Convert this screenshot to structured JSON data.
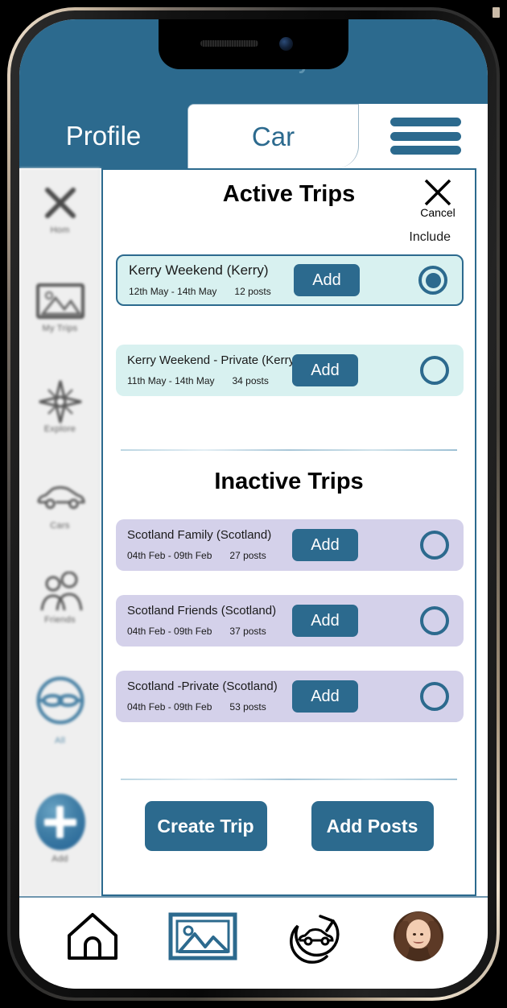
{
  "header": {
    "journey_status": "No Journey",
    "tabs": [
      {
        "label": "Profile",
        "active": false
      },
      {
        "label": "Car",
        "active": true
      }
    ],
    "menu_icon": "hamburger-icon"
  },
  "sidebar": {
    "items": [
      {
        "label": "Hom",
        "icon": "close-x-icon"
      },
      {
        "label": "My Trips",
        "icon": "photo-icon"
      },
      {
        "label": "Explore",
        "icon": "compass-icon"
      },
      {
        "label": "Cars",
        "icon": "car-icon"
      },
      {
        "label": "Friends",
        "icon": "friends-icon"
      },
      {
        "label": "All",
        "icon": "link-circle-icon"
      },
      {
        "label": "Add",
        "icon": "plus-circle-icon"
      }
    ]
  },
  "modal": {
    "title": "Active Trips",
    "cancel_label": "Cancel",
    "cancel_icon": "close-x-icon",
    "include_label": "Include",
    "inactive_title": "Inactive Trips",
    "active_trips": [
      {
        "name": "Kerry Weekend (Kerry)",
        "dates": "12th May - 14th May",
        "posts": "12 posts",
        "add_label": "Add",
        "selected": true
      },
      {
        "name": "Kerry Weekend - Private (Kerry)",
        "dates": "11th May - 14th May",
        "posts": "34 posts",
        "add_label": "Add",
        "selected": false
      }
    ],
    "inactive_trips": [
      {
        "name": "Scotland Family (Scotland)",
        "dates": "04th Feb - 09th Feb",
        "posts": "27 posts",
        "add_label": "Add",
        "selected": false
      },
      {
        "name": "Scotland Friends (Scotland)",
        "dates": "04th Feb - 09th Feb",
        "posts": "37 posts",
        "add_label": "Add",
        "selected": false
      },
      {
        "name": "Scotland -Private (Scotland)",
        "dates": "04th Feb - 09th Feb",
        "posts": "53 posts",
        "add_label": "Add",
        "selected": false
      }
    ],
    "create_trip_label": "Create Trip",
    "add_posts_label": "Add Posts"
  },
  "bottom_nav": {
    "items": [
      {
        "icon": "home-icon",
        "active": false
      },
      {
        "icon": "gallery-icon",
        "active": true
      },
      {
        "icon": "car-refresh-icon",
        "active": false
      },
      {
        "icon": "avatar-icon",
        "active": false
      }
    ]
  },
  "colors": {
    "brand_blue": "#2c6a8e",
    "header_text_muted": "#5e93af",
    "active_card_bg": "#d8f1f0",
    "inactive_card_bg": "#d4d1ea",
    "sidebar_bg": "#efefef"
  }
}
